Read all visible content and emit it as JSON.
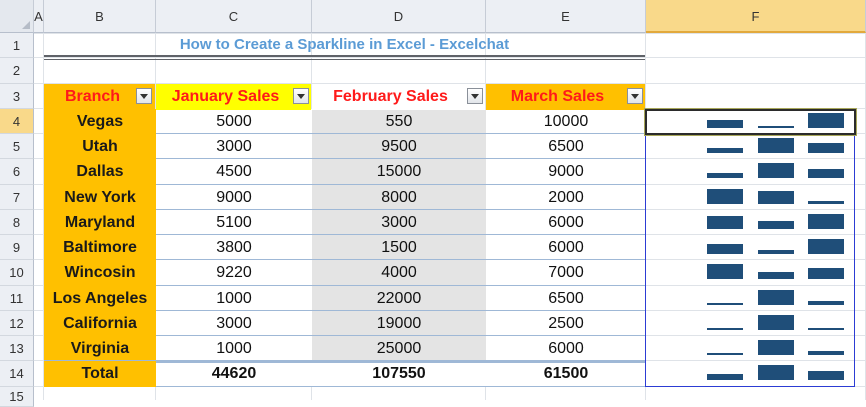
{
  "spreadsheet": {
    "columns": [
      "A",
      "B",
      "C",
      "D",
      "E",
      "F"
    ],
    "selected_column": "F",
    "rows": [
      "1",
      "2",
      "3",
      "4",
      "5",
      "6",
      "7",
      "8",
      "9",
      "10",
      "11",
      "12",
      "13",
      "14",
      "15"
    ],
    "selected_row": "4",
    "selected_cell": "F4"
  },
  "title": "How to Create a Sparkline in Excel - Excelchat",
  "table": {
    "headers": [
      "Branch",
      "January Sales",
      "February Sales",
      "March Sales"
    ],
    "header_colors": {
      "branch_bg": "#ffc000",
      "january_bg": "#ffff00",
      "march_bg": "#ffc000",
      "text": "#ff1a1a"
    },
    "rows": [
      {
        "branch": "Vegas",
        "january": "5000",
        "february": "550",
        "march": "10000",
        "spark": [
          5000,
          550,
          10000
        ]
      },
      {
        "branch": "Utah",
        "january": "3000",
        "february": "9500",
        "march": "6500",
        "spark": [
          3000,
          9500,
          6500
        ]
      },
      {
        "branch": "Dallas",
        "january": "4500",
        "february": "15000",
        "march": "9000",
        "spark": [
          4500,
          15000,
          9000
        ]
      },
      {
        "branch": "New York",
        "january": "9000",
        "february": "8000",
        "march": "2000",
        "spark": [
          9000,
          8000,
          2000
        ]
      },
      {
        "branch": "Maryland",
        "january": "5100",
        "february": "3000",
        "march": "6000",
        "spark": [
          5100,
          3000,
          6000
        ]
      },
      {
        "branch": "Baltimore",
        "january": "3800",
        "february": "1500",
        "march": "6000",
        "spark": [
          3800,
          1500,
          6000
        ]
      },
      {
        "branch": "Wincosin",
        "january": "9220",
        "february": "4000",
        "march": "7000",
        "spark": [
          9220,
          4000,
          7000
        ]
      },
      {
        "branch": "Los Angeles",
        "january": "1000",
        "february": "22000",
        "march": "6500",
        "spark": [
          1000,
          22000,
          6500
        ]
      },
      {
        "branch": "California",
        "january": "3000",
        "february": "19000",
        "march": "2500",
        "spark": [
          3000,
          19000,
          2500
        ]
      },
      {
        "branch": "Virginia",
        "january": "1000",
        "february": "25000",
        "march": "6000",
        "spark": [
          1000,
          25000,
          6000
        ]
      }
    ],
    "total": {
      "label": "Total",
      "january": "44620",
      "february": "107550",
      "march": "61500",
      "spark": [
        44620,
        107550,
        61500
      ]
    }
  },
  "colors": {
    "branch_cell_bg": "#ffc000",
    "february_col_bg": "#e4e4e4",
    "sparkline_bar": "#1f4e79",
    "sparkline_range_border": "#2c3cd4"
  }
}
